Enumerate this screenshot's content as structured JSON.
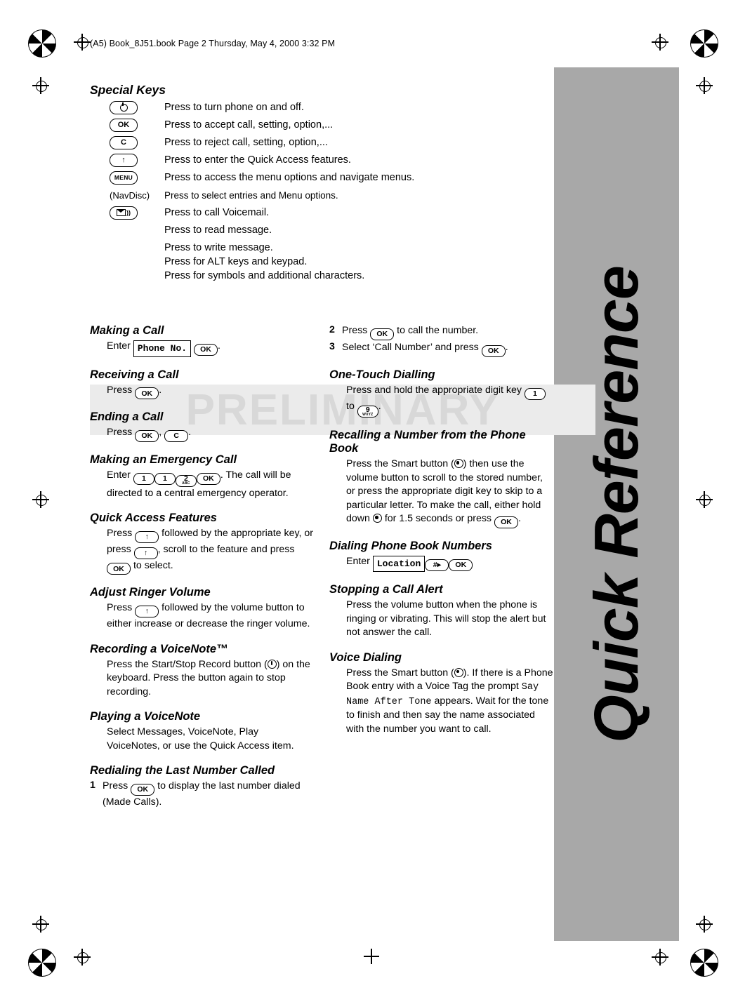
{
  "header": {
    "file_line": "(A5) Book_8J51.book  Page 2  Thursday, May 4, 2000  3:32 PM"
  },
  "watermark": {
    "text": "PRELIMINARY"
  },
  "sideband": {
    "title": "Quick Reference"
  },
  "special_keys": {
    "heading": "Special Keys",
    "rows": [
      {
        "key": "power-key",
        "label": "",
        "desc": "Press to turn phone on and off."
      },
      {
        "key": "ok-key",
        "label": "OK",
        "desc": "Press to accept call, setting, option,..."
      },
      {
        "key": "c-key",
        "label": "C",
        "desc": "Press to reject call, setting, option,..."
      },
      {
        "key": "up-arrow-key",
        "label": "↑",
        "desc": "Press to enter the Quick Access features."
      },
      {
        "key": "menu-key",
        "label": "MENU",
        "desc": "Press to access the menu options and navigate menus."
      },
      {
        "key": "navdisc-text",
        "label": "(NavDisc)",
        "desc": "Press to select entries and Menu options."
      },
      {
        "key": "voicemail-key",
        "label": "",
        "desc": "Press to call Voicemail."
      },
      {
        "key": "",
        "label": "",
        "desc": "Press to read message."
      },
      {
        "key": "",
        "label": "",
        "desc": "Press to write message."
      },
      {
        "key": "",
        "label": "",
        "desc": "Press for ALT keys and keypad."
      },
      {
        "key": "",
        "label": "",
        "desc": "Press for symbols and additional characters."
      }
    ]
  },
  "left_column": {
    "making_a_call": {
      "heading": "Making a Call",
      "enter_label": "Enter",
      "field": "Phone No.",
      "ok": "OK",
      "period": "."
    },
    "receiving_a_call": {
      "heading": "Receiving a Call",
      "press_label": "Press",
      "ok": "OK",
      "period": "."
    },
    "ending_a_call": {
      "heading": "Ending a Call",
      "press_label": "Press",
      "ok": "OK",
      "comma": ",",
      "c": "C",
      "period": "."
    },
    "emergency": {
      "heading": "Making an Emergency Call",
      "enter_label": "Enter",
      "k1": "1",
      "k1b": "1",
      "k2": "2",
      "k2sub": "ABC",
      "ok": "OK",
      "text": ". The call will be directed to a central emergency operator."
    },
    "quick_access": {
      "heading": "Quick Access Features",
      "t1": "Press",
      "t2": "followed by the appropriate key, or press",
      "t3": ", scroll to the feature and press",
      "t4": "to select.",
      "arrow": "↑",
      "ok": "OK"
    },
    "ringer": {
      "heading": "Adjust Ringer Volume",
      "t1": "Press",
      "arrow": "↑",
      "t2": "followed by the volume button to either increase or decrease the ringer volume."
    },
    "voicenote": {
      "heading": "Recording a VoiceNote™",
      "t1": "Press the Start/Stop Record button (",
      "t2": ") on the keyboard. Press the button again to stop recording."
    },
    "playing": {
      "heading": "Playing a VoiceNote",
      "text": "Select Messages, VoiceNote, Play VoiceNotes, or use the Quick Access item."
    },
    "redial": {
      "heading": "Redialing the Last Number Called",
      "step1_num": "1",
      "step1_a": "Press",
      "step1_ok": "OK",
      "step1_b": "to display the last number dialed (Made Calls)."
    }
  },
  "right_column": {
    "redial_cont": {
      "step2_num": "2",
      "step2_a": "Press",
      "step2_ok": "OK",
      "step2_b": "to call the number.",
      "step3_num": "3",
      "step3_a": "Select ‘Call Number’ and press",
      "step3_ok": "OK",
      "step3_b": "."
    },
    "one_touch": {
      "heading": "One-Touch Dialling",
      "t1": "Press and hold the appropriate digit key",
      "k1": "1",
      "to": "to",
      "k9": "9",
      "k9sub": "WXYZ",
      "period": "."
    },
    "recalling": {
      "heading": "Recalling a Number from the Phone Book",
      "t1": "Press the Smart button (",
      "t2": ") then use the volume button to scroll to the stored number, or press the appropriate digit key to skip to a particular letter. To make the call, either hold down",
      "t3": "for 1.5 seconds or press",
      "ok": "OK",
      "t4": "."
    },
    "dialing_pb": {
      "heading": "Dialing Phone Book Numbers",
      "enter_label": "Enter",
      "field": "Location",
      "hash": "#▸",
      "ok": "OK"
    },
    "stopping": {
      "heading": "Stopping a Call Alert",
      "text": "Press the volume button when the phone is ringing or vibrating. This will stop the alert but not answer the call."
    },
    "voice_dialing": {
      "heading": "Voice Dialing",
      "t1": "Press the Smart button (",
      "t2": "). If there is a Phone Book entry with a Voice Tag the prompt",
      "prompt": "Say Name After Tone",
      "t3": "appears. Wait for the tone to finish and then say the name associated with the number you want to call."
    }
  },
  "colors": {
    "sideband": "#a8a8a8",
    "watermark_bg": "#ebebeb",
    "watermark_text": "#d8d8d8"
  }
}
